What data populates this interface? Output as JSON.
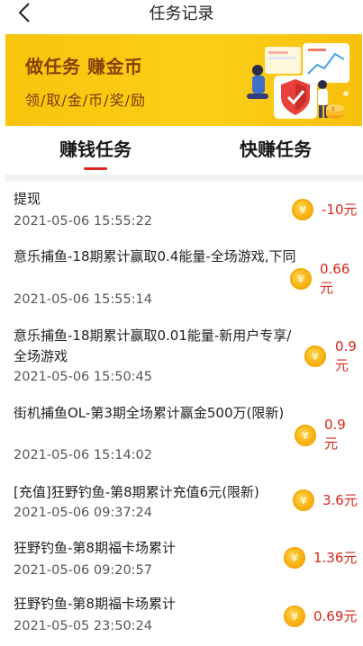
{
  "nav": {
    "title": "任务记录"
  },
  "banner": {
    "title": "做任务 赚金币",
    "subtitle": "领/取/金/币/奖/励"
  },
  "tabs": [
    {
      "label": "赚钱任务"
    },
    {
      "label": "快赚任务"
    }
  ],
  "coin_glyph": "¥",
  "records": [
    {
      "title": "提现",
      "time": "2021-05-06 15:55:22",
      "amount": "-10元"
    },
    {
      "title": "意乐捕鱼-18期累计赢取0.4能量-全场游戏,下同",
      "time": "2021-05-06 15:55:14",
      "amount": "0.66元"
    },
    {
      "title": "意乐捕鱼-18期累计赢取0.01能量-新用户专享/全场游戏",
      "time": "2021-05-06 15:50:45",
      "amount": "0.9元"
    },
    {
      "title": "街机捕鱼OL-第3期全场累计赢金500万(限新)",
      "time": "2021-05-06 15:14:02",
      "amount": "0.9元"
    },
    {
      "title": "[充值]狂野钓鱼-第8期累计充值6元(限新)",
      "time": "2021-05-06 09:37:24",
      "amount": "3.6元"
    },
    {
      "title": "狂野钓鱼-第8期福卡场累计",
      "time": "2021-05-06 09:20:57",
      "amount": "1.36元"
    },
    {
      "title": "狂野钓鱼-第8期福卡场累计",
      "time": "2021-05-05 23:50:24",
      "amount": "0.69元"
    }
  ]
}
